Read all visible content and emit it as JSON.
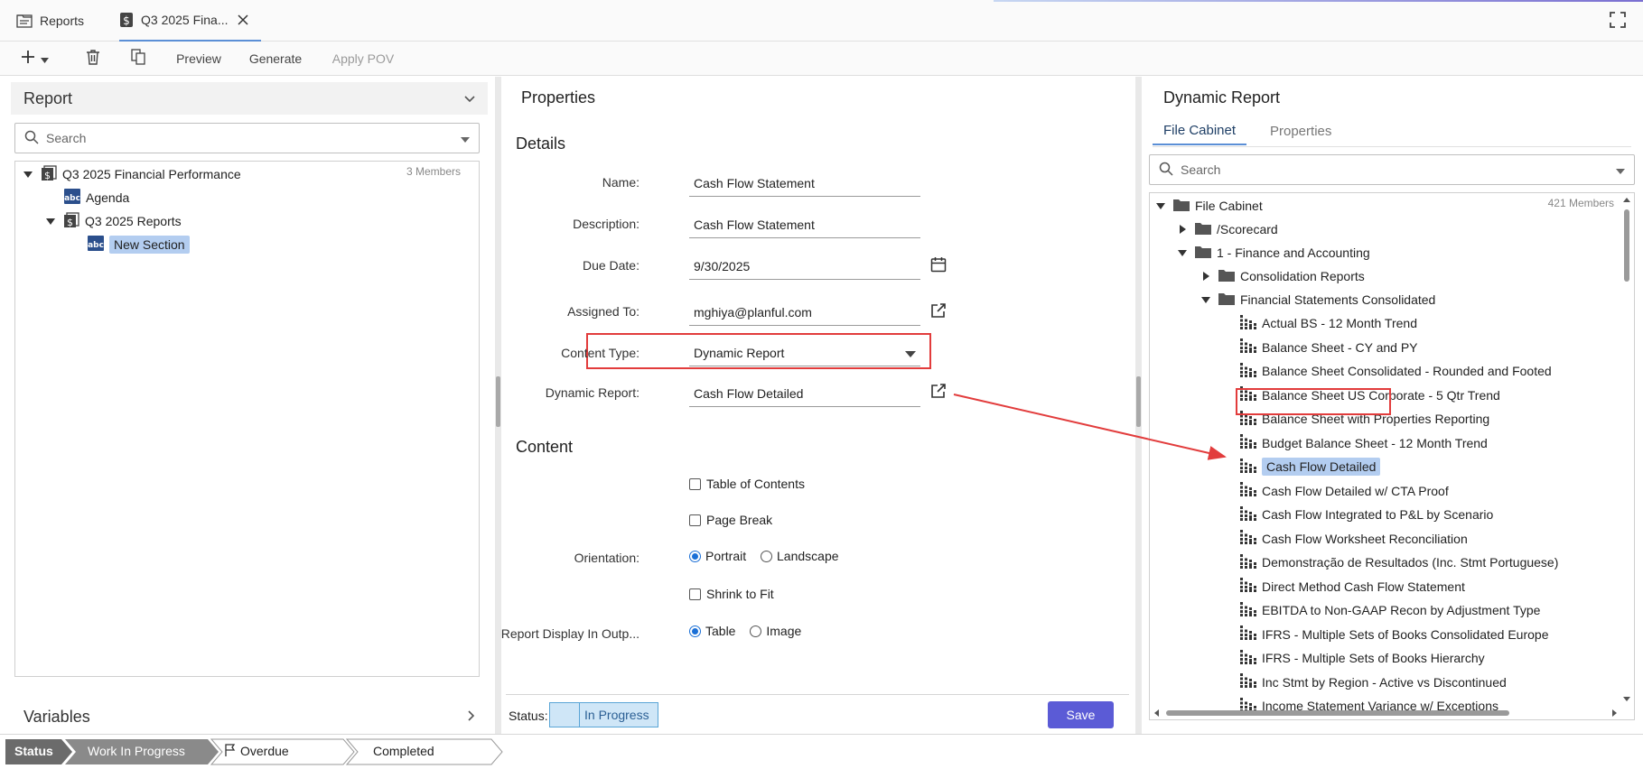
{
  "tabs": [
    {
      "label": "Reports",
      "icon": "reports-icon"
    },
    {
      "label": "Q3 2025 Fina...",
      "icon": "dollar-doc-icon"
    }
  ],
  "toolbar": {
    "preview": "Preview",
    "generate": "Generate",
    "apply_pov": "Apply POV"
  },
  "left": {
    "title": "Report",
    "search_placeholder": "Search",
    "members": "3 Members",
    "tree": {
      "root": "Q3 2025 Financial Performance",
      "agenda": "Agenda",
      "reports": "Q3 2025 Reports",
      "new_section": "New Section"
    },
    "variables": "Variables"
  },
  "middle": {
    "title": "Properties",
    "details_title": "Details",
    "content_title": "Content",
    "labels": {
      "name": "Name:",
      "description": "Description:",
      "due_date": "Due Date:",
      "assigned_to": "Assigned To:",
      "content_type": "Content Type:",
      "dynamic_report": "Dynamic Report:",
      "orientation": "Orientation:",
      "display": "Report Display In Outp..."
    },
    "values": {
      "name": "Cash Flow Statement",
      "description": "Cash Flow Statement",
      "due_date": "9/30/2025",
      "assigned_to": "mghiya@planful.com",
      "content_type": "Dynamic Report",
      "dynamic_report": "Cash Flow Detailed"
    },
    "checkboxes": {
      "toc": "Table of Contents",
      "page_break": "Page Break",
      "shrink": "Shrink to Fit"
    },
    "orientation": {
      "portrait": "Portrait",
      "landscape": "Landscape",
      "selected": "portrait"
    },
    "display": {
      "table": "Table",
      "image": "Image",
      "selected": "table"
    },
    "status_label": "Status:",
    "status_value": "In Progress",
    "save": "Save"
  },
  "right": {
    "title": "Dynamic Report",
    "tab_file_cabinet": "File Cabinet",
    "tab_properties": "Properties",
    "search_placeholder": "Search",
    "members": "421 Members",
    "tree": {
      "root": "File Cabinet",
      "scorecard": "/Scorecard",
      "finance": "1 - Finance and Accounting",
      "consolidation": "Consolidation Reports",
      "fsc": "Financial Statements Consolidated"
    },
    "items": [
      "Actual BS - 12 Month Trend",
      "Balance Sheet - CY and PY",
      "Balance Sheet Consolidated - Rounded and Footed",
      "Balance Sheet US Corporate - 5 Qtr Trend",
      "Balance Sheet with Properties Reporting",
      "Budget Balance Sheet - 12 Month Trend",
      "Cash Flow Detailed",
      "Cash Flow Detailed w/ CTA Proof",
      "Cash Flow Integrated to P&L by Scenario",
      "Cash Flow Worksheet Reconciliation",
      "Demonstração de Resultados (Inc. Stmt Portuguese)",
      "Direct Method Cash Flow Statement",
      "EBITDA to Non-GAAP Recon by Adjustment Type",
      "IFRS - Multiple Sets of Books Consolidated Europe",
      "IFRS - Multiple Sets of Books Hierarchy",
      "Inc Stmt by Region - Active vs Discontinued",
      "Income Statement Variance w/ Exceptions"
    ]
  },
  "status_bar": {
    "status": "Status",
    "work_in_progress": "Work In Progress",
    "overdue": "Overdue",
    "completed": "Completed"
  },
  "colors": {
    "accent": "#5b8fd6",
    "save_button": "#5b5bd6",
    "highlight": "#e23c3c",
    "selection": "#b3cdf0"
  }
}
